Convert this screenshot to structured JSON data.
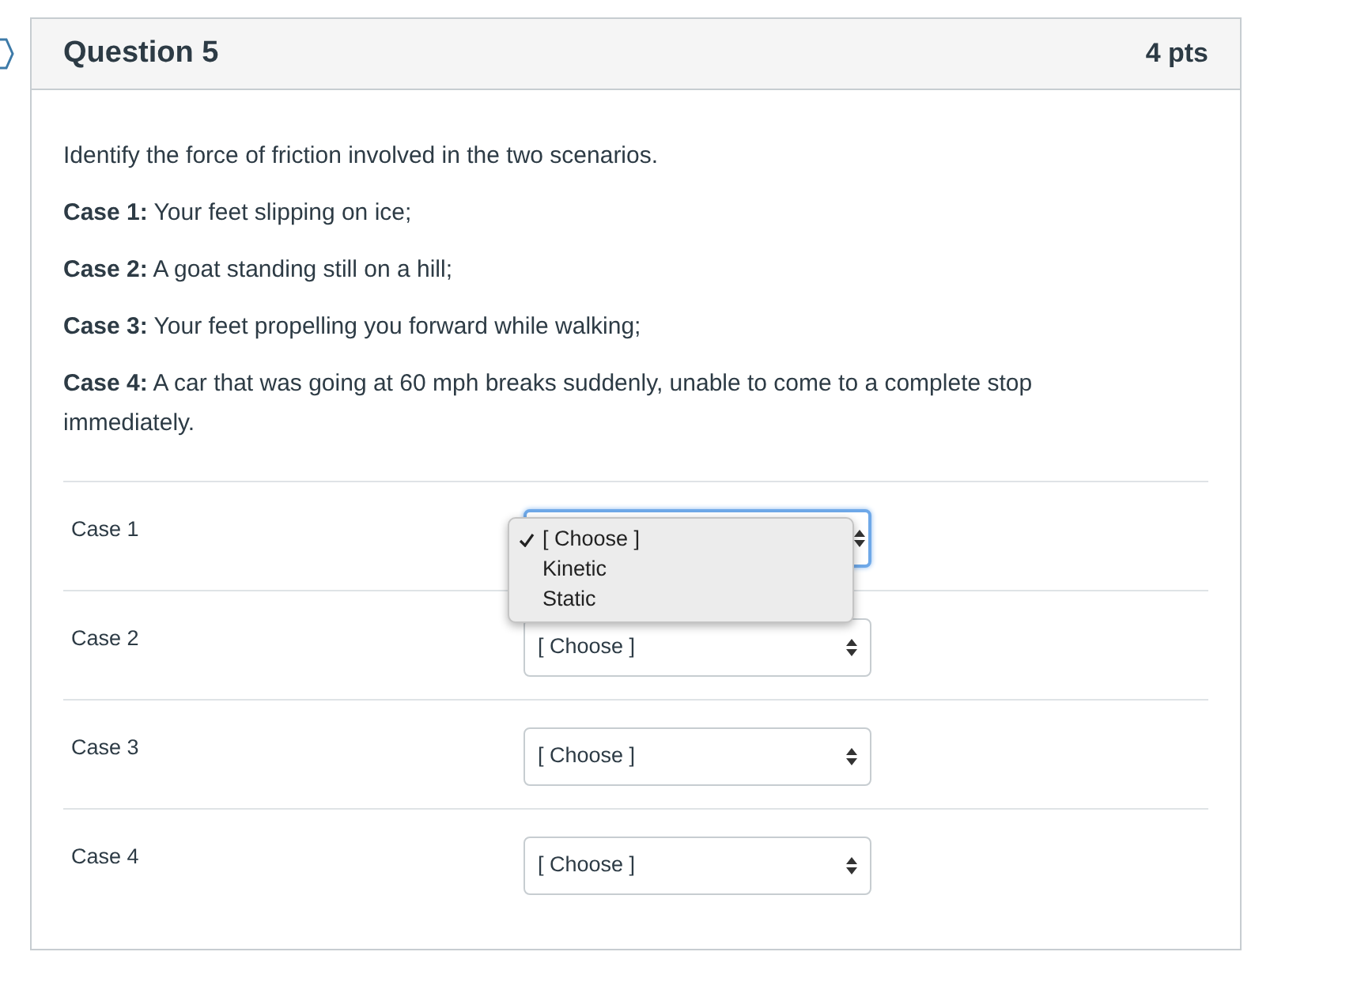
{
  "question": {
    "title": "Question 5",
    "points": "4 pts"
  },
  "statements": [
    "Identify the force of friction involved in the two scenarios.",
    "**Case 1:** Your feet slipping on ice;",
    "**Case 2:** A goat standing still on a hill;",
    "**Case 3:** Your feet propelling you forward while walking;",
    "**Case 4:** A car that was going at 60 mph breaks suddenly, unable to come to a complete stop immediately."
  ],
  "cases": [
    {
      "label": "Case 1",
      "open": true,
      "options": [
        {
          "label": "[ Choose ]",
          "selected": true
        },
        {
          "label": "Kinetic",
          "selected": false
        },
        {
          "label": "Static",
          "selected": false
        }
      ]
    },
    {
      "label": "Case 2",
      "open": false,
      "value": "[ Choose ]"
    },
    {
      "label": "Case 3",
      "open": false,
      "value": "[ Choose ]"
    },
    {
      "label": "Case 4",
      "open": false,
      "value": "[ Choose ]"
    }
  ]
}
